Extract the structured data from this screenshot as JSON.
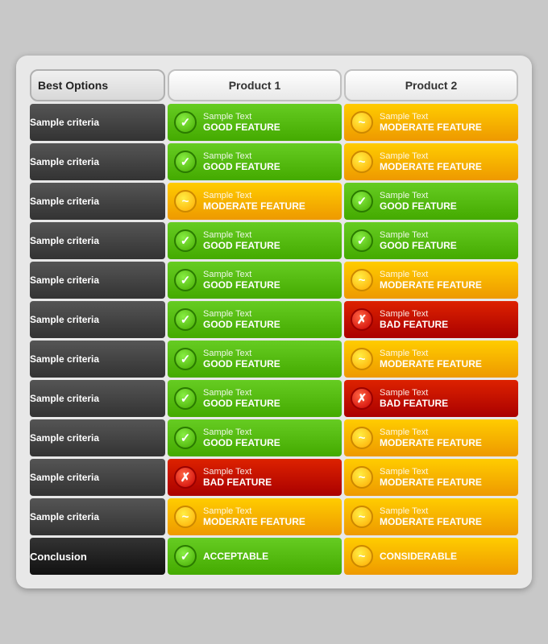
{
  "header": {
    "col1": "Best Options",
    "col2": "Product 1",
    "col3": "Product 2"
  },
  "rows": [
    {
      "criteria": "Sample criteria",
      "p1": {
        "type": "good",
        "sample": "Sample Text",
        "label": "GOOD FEATURE"
      },
      "p2": {
        "type": "moderate",
        "sample": "Sample Text",
        "label": "MODERATE FEATURE"
      }
    },
    {
      "criteria": "Sample criteria",
      "p1": {
        "type": "good",
        "sample": "Sample Text",
        "label": "GOOD FEATURE"
      },
      "p2": {
        "type": "moderate",
        "sample": "Sample Text",
        "label": "MODERATE FEATURE"
      }
    },
    {
      "criteria": "Sample criteria",
      "p1": {
        "type": "moderate",
        "sample": "Sample Text",
        "label": "MODERATE FEATURE"
      },
      "p2": {
        "type": "good",
        "sample": "Sample Text",
        "label": "GOOD FEATURE"
      }
    },
    {
      "criteria": "Sample criteria",
      "p1": {
        "type": "good",
        "sample": "Sample Text",
        "label": "GOOD FEATURE"
      },
      "p2": {
        "type": "good",
        "sample": "Sample Text",
        "label": "GOOD FEATURE"
      }
    },
    {
      "criteria": "Sample criteria",
      "p1": {
        "type": "good",
        "sample": "Sample Text",
        "label": "GOOD FEATURE"
      },
      "p2": {
        "type": "moderate",
        "sample": "Sample Text",
        "label": "MODERATE FEATURE"
      }
    },
    {
      "criteria": "Sample criteria",
      "p1": {
        "type": "good",
        "sample": "Sample Text",
        "label": "GOOD FEATURE"
      },
      "p2": {
        "type": "bad",
        "sample": "Sample Text",
        "label": "BAD FEATURE"
      }
    },
    {
      "criteria": "Sample criteria",
      "p1": {
        "type": "good",
        "sample": "Sample Text",
        "label": "GOOD FEATURE"
      },
      "p2": {
        "type": "moderate",
        "sample": "Sample Text",
        "label": "MODERATE FEATURE"
      }
    },
    {
      "criteria": "Sample criteria",
      "p1": {
        "type": "good",
        "sample": "Sample Text",
        "label": "GOOD FEATURE"
      },
      "p2": {
        "type": "bad",
        "sample": "Sample Text",
        "label": "BAD FEATURE"
      }
    },
    {
      "criteria": "Sample criteria",
      "p1": {
        "type": "good",
        "sample": "Sample Text",
        "label": "GOOD FEATURE"
      },
      "p2": {
        "type": "moderate",
        "sample": "Sample Text",
        "label": "MODERATE FEATURE"
      }
    },
    {
      "criteria": "Sample criteria",
      "p1": {
        "type": "bad",
        "sample": "Sample Text",
        "label": "BAD FEATURE"
      },
      "p2": {
        "type": "moderate",
        "sample": "Sample Text",
        "label": "MODERATE FEATURE"
      }
    },
    {
      "criteria": "Sample criteria",
      "p1": {
        "type": "moderate",
        "sample": "Sample Text",
        "label": "MODERATE FEATURE"
      },
      "p2": {
        "type": "moderate",
        "sample": "Sample Text",
        "label": "MODERATE FEATURE"
      }
    }
  ],
  "conclusion": {
    "label": "Conclusion",
    "p1": {
      "type": "good",
      "text": "ACCEPTABLE"
    },
    "p2": {
      "type": "moderate",
      "text": "CONSIDERABLE"
    }
  },
  "icons": {
    "good": "✓",
    "moderate": "~",
    "bad": "✗"
  }
}
